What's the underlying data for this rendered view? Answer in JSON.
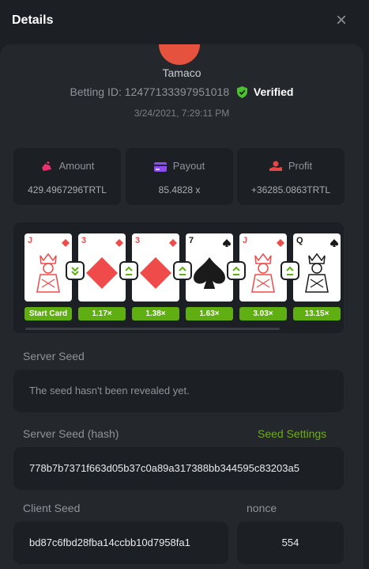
{
  "header": {
    "title": "Details",
    "close_label": "×"
  },
  "user": {
    "name": "Tamaco"
  },
  "bet": {
    "id_label": "Betting ID: 12477133397951018",
    "verified_label": "Verified",
    "timestamp": "3/24/2021, 7:29:11 PM"
  },
  "stats": {
    "amount": {
      "label": "Amount",
      "value": "429.4967296TRTL",
      "icon": "moneybag-icon"
    },
    "payout": {
      "label": "Payout",
      "value": "85.4828 x",
      "icon": "card-icon"
    },
    "profit": {
      "label": "Profit",
      "value": "+36285.0863TRTL",
      "icon": "hand-coin-icon"
    }
  },
  "cards": [
    {
      "rank": "J",
      "suit": "diamond",
      "art": "jack",
      "multiplier": "Start Card"
    },
    {
      "rank": "3",
      "suit": "diamond",
      "art": "pip",
      "multiplier": "1.17×"
    },
    {
      "rank": "3",
      "suit": "diamond",
      "art": "pip",
      "multiplier": "1.38×"
    },
    {
      "rank": "7",
      "suit": "spade",
      "art": "pip",
      "multiplier": "1.63×"
    },
    {
      "rank": "J",
      "suit": "diamond",
      "art": "jack",
      "multiplier": "3.03×"
    },
    {
      "rank": "Q",
      "suit": "spade",
      "art": "queen",
      "multiplier": "13.15×"
    }
  ],
  "arrows": [
    "lower",
    "higher",
    "higher",
    "higher",
    "higher"
  ],
  "server_seed": {
    "label": "Server Seed",
    "value": "The seed hasn't been revealed yet."
  },
  "server_seed_hash": {
    "label": "Server Seed (hash)",
    "link": "Seed Settings",
    "value": "778b7b7371f663d05b37c0a89a317388bb344595c83203a5"
  },
  "client_seed": {
    "label": "Client Seed",
    "value": "bd87c6fbd28fba14ccbb10d7958fa1"
  },
  "nonce": {
    "label": "nonce",
    "value": "554"
  },
  "colors": {
    "accent_green": "#5fae12",
    "link_green": "#6cae1a",
    "card_red": "#ef4b4b",
    "background": "#1c1f23",
    "panel": "#24272b"
  }
}
